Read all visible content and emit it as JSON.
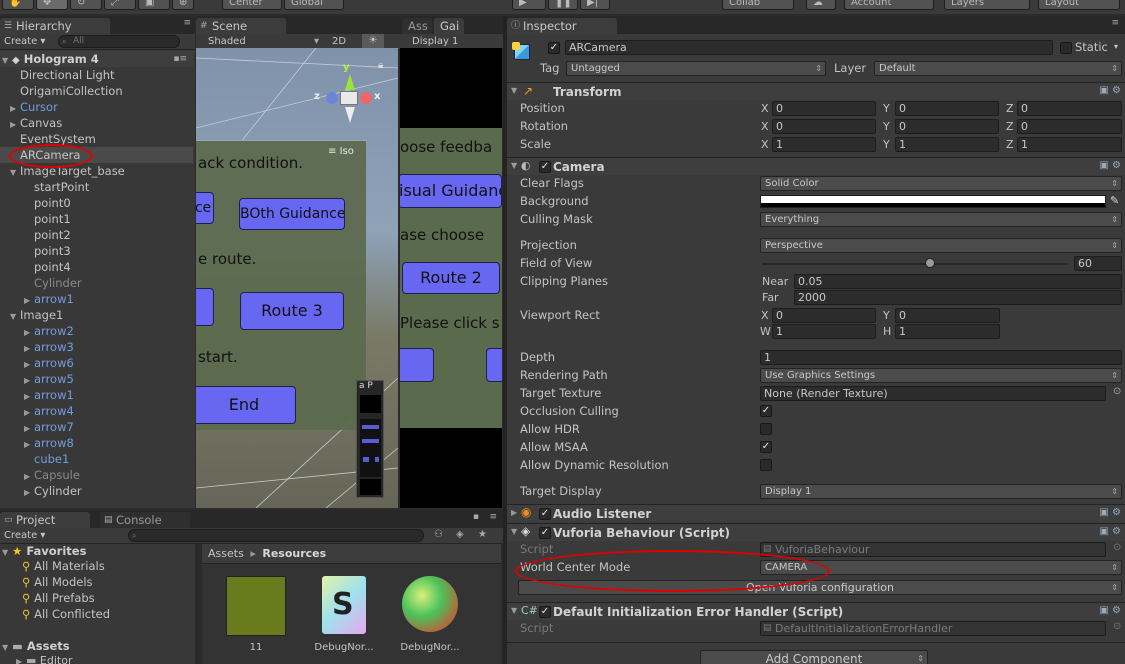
{
  "toolbar": {
    "center": "Center",
    "global": "Global",
    "collab": "Collab",
    "account": "Account",
    "layers": "Layers",
    "layout": "Layout"
  },
  "hierarchy": {
    "tab": "Hierarchy",
    "create": "Create",
    "search_placeholder": "All",
    "scene": "Hologram 4",
    "items": [
      {
        "label": "Directional Light",
        "indent": 1,
        "style": "normal",
        "fold": ""
      },
      {
        "label": "OrigamiCollection",
        "indent": 1,
        "style": "normal",
        "fold": ""
      },
      {
        "label": "Cursor",
        "indent": 1,
        "style": "blue",
        "fold": "▶"
      },
      {
        "label": "Canvas",
        "indent": 1,
        "style": "normal",
        "fold": "▶"
      },
      {
        "label": "EventSystem",
        "indent": 1,
        "style": "normal",
        "fold": ""
      },
      {
        "label": "ARCamera",
        "indent": 1,
        "style": "normal",
        "fold": "",
        "selected": true
      },
      {
        "label": "ImageTarget_base",
        "indent": 1,
        "style": "normal",
        "fold": "▼"
      },
      {
        "label": "startPoint",
        "indent": 2,
        "style": "normal",
        "fold": ""
      },
      {
        "label": "point0",
        "indent": 2,
        "style": "normal",
        "fold": ""
      },
      {
        "label": "point1",
        "indent": 2,
        "style": "normal",
        "fold": ""
      },
      {
        "label": "point2",
        "indent": 2,
        "style": "normal",
        "fold": ""
      },
      {
        "label": "point3",
        "indent": 2,
        "style": "normal",
        "fold": ""
      },
      {
        "label": "point4",
        "indent": 2,
        "style": "normal",
        "fold": ""
      },
      {
        "label": "Cylinder",
        "indent": 2,
        "style": "grey",
        "fold": ""
      },
      {
        "label": "arrow1",
        "indent": 2,
        "style": "blue",
        "fold": "▶"
      },
      {
        "label": "Image1",
        "indent": 1,
        "style": "normal",
        "fold": "▼"
      },
      {
        "label": "arrow2",
        "indent": 2,
        "style": "blue",
        "fold": "▶"
      },
      {
        "label": "arrow3",
        "indent": 2,
        "style": "blue",
        "fold": "▶"
      },
      {
        "label": "arrow6",
        "indent": 2,
        "style": "blue",
        "fold": "▶"
      },
      {
        "label": "arrow5",
        "indent": 2,
        "style": "blue",
        "fold": "▶"
      },
      {
        "label": "arrow1",
        "indent": 2,
        "style": "blue",
        "fold": "▶"
      },
      {
        "label": "arrow4",
        "indent": 2,
        "style": "blue",
        "fold": "▶"
      },
      {
        "label": "arrow7",
        "indent": 2,
        "style": "blue",
        "fold": "▶"
      },
      {
        "label": "arrow8",
        "indent": 2,
        "style": "blue",
        "fold": "▶"
      },
      {
        "label": "cube1",
        "indent": 2,
        "style": "blue",
        "fold": ""
      },
      {
        "label": "Capsule",
        "indent": 2,
        "style": "grey",
        "fold": "▶"
      },
      {
        "label": "Cylinder",
        "indent": 2,
        "style": "normal",
        "fold": "▶"
      }
    ]
  },
  "scene": {
    "tab": "Scene",
    "shading": "Shaded",
    "mode_2d": "2D",
    "iso": "Iso",
    "axis_y": "y",
    "axis_x": "x",
    "axis_z": "z",
    "texts": {
      "line1": "ack condition.",
      "btn_ce": "ce",
      "btn_both": "BOth Guidance",
      "line2": "e route.",
      "btn_route3": "Route 3",
      "line3": "start.",
      "btn_end": "End",
      "camera_preview_label": "a P"
    }
  },
  "game": {
    "tab_asset": "Ass",
    "tab_game": "Gai",
    "display": "Display 1",
    "texts": {
      "line1": "oose feedba",
      "btn_visual": "isual Guidanc",
      "line2": "ase choose",
      "btn_route2": "Route 2",
      "line3": "Please click  s"
    }
  },
  "project": {
    "tab_project": "Project",
    "tab_console": "Console",
    "create": "Create",
    "favorites": "Favorites",
    "fav_items": [
      "All Materials",
      "All Models",
      "All Prefabs",
      "All Conflicted"
    ],
    "assets": "Assets",
    "editor": "Editor",
    "breadcrumb_root": "Assets",
    "breadcrumb_sep": "▸",
    "breadcrumb_current": "Resources",
    "asset_items": [
      "11",
      "DebugNor...",
      "DebugNor..."
    ]
  },
  "inspector": {
    "tab": "Inspector",
    "object_name": "ARCamera",
    "static_label": "Static",
    "tag_label": "Tag",
    "tag_value": "Untagged",
    "layer_label": "Layer",
    "layer_value": "Default",
    "transform": {
      "title": "Transform",
      "position_label": "Position",
      "rotation_label": "Rotation",
      "scale_label": "Scale",
      "position": [
        "0",
        "0",
        "0"
      ],
      "rotation": [
        "0",
        "0",
        "0"
      ],
      "scale": [
        "1",
        "1",
        "1"
      ]
    },
    "camera": {
      "title": "Camera",
      "clear_flags_label": "Clear Flags",
      "clear_flags": "Solid Color",
      "background_label": "Background",
      "background_color": "#000000",
      "culling_mask_label": "Culling Mask",
      "culling_mask": "Everything",
      "projection_label": "Projection",
      "projection": "Perspective",
      "fov_label": "Field of View",
      "fov": "60",
      "fov_fraction": 0.55,
      "clipping_label": "Clipping Planes",
      "near_label": "Near",
      "near": "0.05",
      "far_label": "Far",
      "far": "2000",
      "viewport_label": "Viewport Rect",
      "viewport": {
        "x": "0",
        "y": "0",
        "w": "1",
        "h": "1"
      },
      "depth_label": "Depth",
      "depth": "1",
      "rendering_path_label": "Rendering Path",
      "rendering_path": "Use Graphics Settings",
      "target_texture_label": "Target Texture",
      "target_texture": "None (Render Texture)",
      "occlusion_label": "Occlusion Culling",
      "hdr_label": "Allow HDR",
      "msaa_label": "Allow MSAA",
      "dynres_label": "Allow Dynamic Resolution",
      "target_display_label": "Target Display",
      "target_display": "Display 1"
    },
    "audio_listener": {
      "title": "Audio Listener"
    },
    "vuforia": {
      "title": "Vuforia Behaviour (Script)",
      "script_label": "Script",
      "script_value": "VuforiaBehaviour",
      "world_center_label": "World Center Mode",
      "world_center_value": "CAMERA",
      "open_config": "Open Vuforia configuration"
    },
    "error_handler": {
      "title": "Default Initialization Error Handler (Script)",
      "script_label": "Script",
      "script_value": "DefaultInitializationErrorHandler"
    },
    "add_component": "Add Component",
    "axes": {
      "x": "X",
      "y": "Y",
      "z": "Z",
      "w": "W",
      "h": "H"
    }
  }
}
